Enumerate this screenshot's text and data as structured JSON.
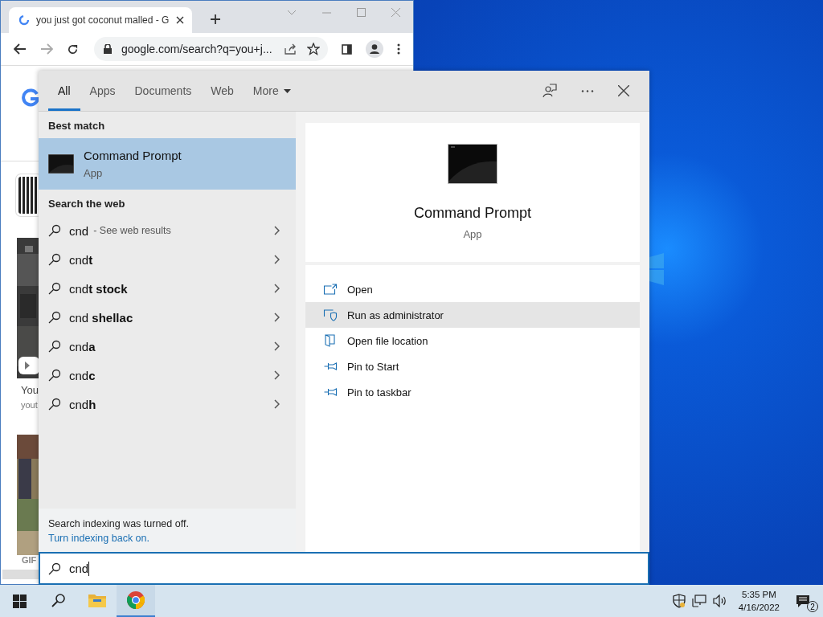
{
  "browser": {
    "tab_title": "you just got coconut malled - G",
    "address": "google.com/search?q=you+j...",
    "page_texts": [
      "You",
      "yout",
      "GIF"
    ]
  },
  "search": {
    "tabs": [
      {
        "label": "All",
        "selected": true,
        "kind": "plain"
      },
      {
        "label": "Apps",
        "selected": false,
        "kind": "plain"
      },
      {
        "label": "Documents",
        "selected": false,
        "kind": "plain"
      },
      {
        "label": "Web",
        "selected": false,
        "kind": "plain"
      },
      {
        "label": "More",
        "selected": false,
        "kind": "dropdown"
      }
    ],
    "best_match_heading": "Best match",
    "best_match": {
      "title": "Command Prompt",
      "subtitle": "App",
      "selected": true
    },
    "web_heading": "Search the web",
    "suggestions": [
      {
        "text": "cnd",
        "hint": "- See web results"
      },
      {
        "text": "cnd**t**"
      },
      {
        "text": "cnd**t stock**"
      },
      {
        "text": "cnd **shellac**"
      },
      {
        "text": "cnd**a**"
      },
      {
        "text": "cnd**c**"
      },
      {
        "text": "cnd**h**"
      }
    ],
    "notice": "Search indexing was turned off.",
    "notice_link": "Turn indexing back on.",
    "query": "cnd",
    "detail": {
      "title": "Command Prompt",
      "subtitle": "App",
      "actions": [
        {
          "label": "Open",
          "kind": "open",
          "selected": false
        },
        {
          "label": "Run as administrator",
          "kind": "admin",
          "selected": true
        },
        {
          "label": "Open file location",
          "kind": "folder",
          "selected": false
        },
        {
          "label": "Pin to Start",
          "kind": "pin",
          "selected": false
        },
        {
          "label": "Pin to taskbar",
          "kind": "pin",
          "selected": false
        }
      ]
    }
  },
  "taskbar": {
    "apps": [
      {
        "kind": "search",
        "selected": false
      },
      {
        "kind": "folder",
        "selected": false
      },
      {
        "kind": "chrome",
        "selected": true
      }
    ],
    "time": "5:35 PM",
    "date": "4/16/2022",
    "notifications": "2"
  }
}
